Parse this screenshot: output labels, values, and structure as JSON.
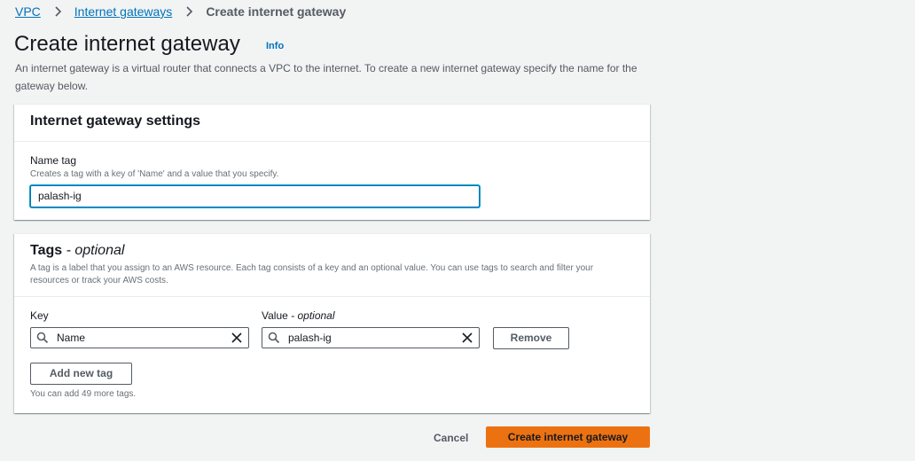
{
  "breadcrumb": {
    "items": [
      {
        "label": "VPC"
      },
      {
        "label": "Internet gateways"
      },
      {
        "label": "Create internet gateway"
      }
    ]
  },
  "header": {
    "title": "Create internet gateway",
    "info_link": "Info",
    "description": "An internet gateway is a virtual router that connects a VPC to the internet. To create a new internet gateway specify the name for the gateway below."
  },
  "settings": {
    "title": "Internet gateway settings",
    "name_tag": {
      "label": "Name tag",
      "description": "Creates a tag with a key of 'Name' and a value that you specify.",
      "value": "palash-ig"
    }
  },
  "tags": {
    "title": "Tags",
    "title_optional": " - optional",
    "description": "A tag is a label that you assign to an AWS resource. Each tag consists of a key and an optional value. You can use tags to search and filter your resources or track your AWS costs.",
    "key_label": "Key",
    "value_label": "Value",
    "value_optional": " - optional",
    "rows": [
      {
        "key": "Name",
        "value": "palash-ig",
        "remove_label": "Remove"
      }
    ],
    "add_button": "Add new tag",
    "limit_hint": "You can add 49 more tags."
  },
  "footer": {
    "cancel": "Cancel",
    "submit": "Create internet gateway"
  },
  "colors": {
    "link": "#0073bb",
    "primary": "#ec7211",
    "background": "#f2f3f3"
  }
}
